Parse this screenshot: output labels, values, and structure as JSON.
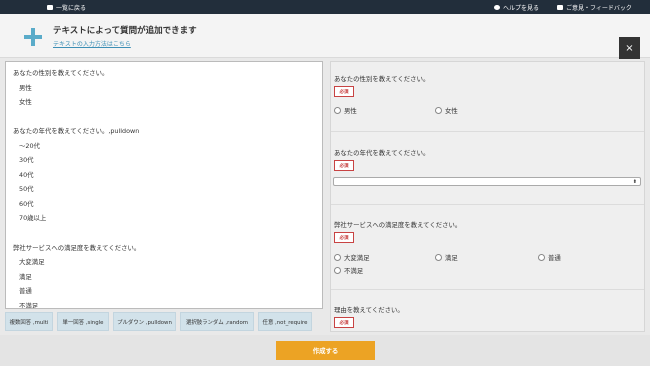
{
  "topbar": {
    "back_label": "一覧に戻る",
    "help_label": "ヘルプを見る",
    "feedback_label": "ご意見・フィードバック"
  },
  "header": {
    "title": "テキストによって質問が追加できます",
    "help_link": "テキストの入力方法はこちら",
    "close_label": "×"
  },
  "editor": {
    "lines": [
      {
        "text": "あなたの性別を教えてください。"
      },
      {
        "text": "男性"
      },
      {
        "text": "女性"
      },
      {
        "text": ""
      },
      {
        "text": "あなたの年代を教えてください。,pulldown"
      },
      {
        "text": "〜20代"
      },
      {
        "text": "30代"
      },
      {
        "text": "40代"
      },
      {
        "text": "50代"
      },
      {
        "text": "60代"
      },
      {
        "text": "70歳以上"
      },
      {
        "text": ""
      },
      {
        "text": "弊社サービスへの満足度を教えてください。"
      },
      {
        "text": "大変満足"
      },
      {
        "text": "満足"
      },
      {
        "text": "普通"
      },
      {
        "text": "不満足"
      }
    ]
  },
  "insert_buttons": [
    {
      "label": "複数回答 ,multi"
    },
    {
      "label": "単一回答 ,single"
    },
    {
      "label": "プルダウン ,pulldown"
    },
    {
      "label": "選択肢ランダム ,random"
    },
    {
      "label": "任意 ,not_require"
    }
  ],
  "preview": {
    "required_label": "必須",
    "q1": {
      "title": "あなたの性別を教えてください。",
      "options": [
        "男性",
        "女性"
      ]
    },
    "q2": {
      "title": "あなたの年代を教えてください。",
      "selected": ""
    },
    "q3": {
      "title": "弊社サービスへの満足度を教えてください。",
      "options": [
        "大変満足",
        "満足",
        "普通",
        "不満足"
      ]
    },
    "q4": {
      "title": "理由を教えてください。"
    }
  },
  "footer": {
    "create_label": "作成する"
  },
  "colors": {
    "topbar": "#222e3b",
    "accent_blue": "#5aabc9",
    "required_red": "#c84343",
    "create_orange": "#eca324",
    "insert_button": "#d2e2ea"
  }
}
